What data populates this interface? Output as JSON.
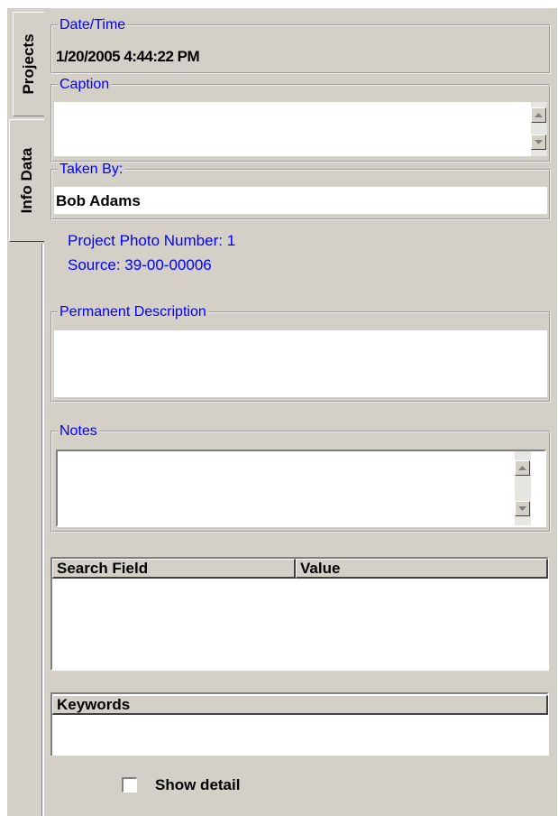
{
  "tabs": [
    {
      "label": "Projects"
    },
    {
      "label": "Info Data"
    }
  ],
  "fields": {
    "datetime": {
      "legend": "Date/Time",
      "value": "1/20/2005 4:44:22 PM"
    },
    "caption": {
      "legend": "Caption",
      "value": ""
    },
    "taken_by": {
      "legend": "Taken By:",
      "value": "Bob Adams"
    },
    "permanent_description": {
      "legend": "Permanent Description",
      "value": ""
    },
    "notes": {
      "legend": "Notes",
      "value": ""
    }
  },
  "info": {
    "photo_number": "Project Photo Number:  1",
    "source": "Source:  39-00-00006"
  },
  "search_table": {
    "columns": [
      "Search Field",
      "Value"
    ],
    "rows": []
  },
  "keywords_table": {
    "columns": [
      "Keywords"
    ],
    "rows": []
  },
  "show_detail": {
    "label": "Show detail",
    "checked": false
  },
  "colors": {
    "panel": "#d4d0c8",
    "label_blue": "#0000ff"
  }
}
